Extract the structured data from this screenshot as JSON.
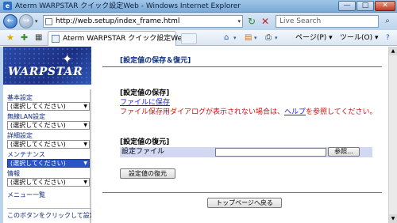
{
  "window": {
    "title": "Aterm WARPSTAR クイック設定Web - Windows Internet Explorer",
    "minimize": "—",
    "maximize": "□",
    "close": "✕"
  },
  "address": {
    "url": "http://web.setup/index_frame.html",
    "search_placeholder": "Live Search"
  },
  "icons": {
    "back": "←",
    "forward": "→",
    "refresh": "↻",
    "stop": "✕",
    "search": "⌕",
    "favorites": "★",
    "add_favorite": "✚",
    "tab_grid": "▦",
    "home": "⌂",
    "feeds": "▤",
    "print": "⎙",
    "dropdown": "▾"
  },
  "tab": {
    "label": "Aterm WARPSTAR クイック設定Web"
  },
  "commands": {
    "page": "ページ(P)",
    "tools": "ツール(O)",
    "help": "?"
  },
  "sidebar": {
    "brand": "WARPSTAR",
    "groups": [
      {
        "label": "基本設定",
        "value": "(選択してください)",
        "active": false
      },
      {
        "label": "無線LAN設定",
        "value": "(選択してください)",
        "active": false
      },
      {
        "label": "詳細設定",
        "value": "(選択してください)",
        "active": false
      },
      {
        "label": "メンテナンス",
        "value": "(選択してください)",
        "active": true
      },
      {
        "label": "情報",
        "value": "(選択してください)",
        "active": false
      }
    ],
    "menu_list": "メニュー一覧",
    "note": "このボタンをクリックして設定を"
  },
  "main": {
    "heading": "[設定値の保存＆復元]",
    "save_section": "[設定値の保存]",
    "save_link": "ファイルに保存",
    "note_before": "ファイル保存用ダイアログが表示されない場合は、",
    "note_link": "ヘルプ",
    "note_after": "を参照してください。",
    "restore_section": "[設定値の復元]",
    "file_label": "設定ファイル",
    "browse_button": "参照...",
    "restore_button": "設定値の復元",
    "top_button": "トップページへ戻る"
  }
}
